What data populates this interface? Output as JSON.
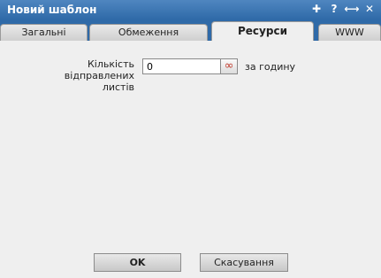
{
  "window": {
    "title": "Новий шаблон",
    "controls": [
      {
        "icon": "pin-icon",
        "glyph": "✚"
      },
      {
        "icon": "help-icon",
        "glyph": "?"
      },
      {
        "icon": "resize-icon",
        "glyph": "⟷"
      },
      {
        "icon": "close-icon",
        "glyph": "✕"
      }
    ]
  },
  "tabs": [
    {
      "label": "Загальні",
      "active": false
    },
    {
      "label": "Обмеження",
      "active": false
    },
    {
      "label": "Ресурси",
      "active": true
    },
    {
      "label": "WWW",
      "active": false
    }
  ],
  "form": {
    "label": "Кількість відправлених листів",
    "value": "0",
    "infinity_glyph": "∞",
    "unit": "за годину"
  },
  "buttons": {
    "ok": "OK",
    "cancel": "Скасування"
  },
  "colors": {
    "titlebar": "#2f6aa8",
    "infinity": "#c0392b"
  }
}
